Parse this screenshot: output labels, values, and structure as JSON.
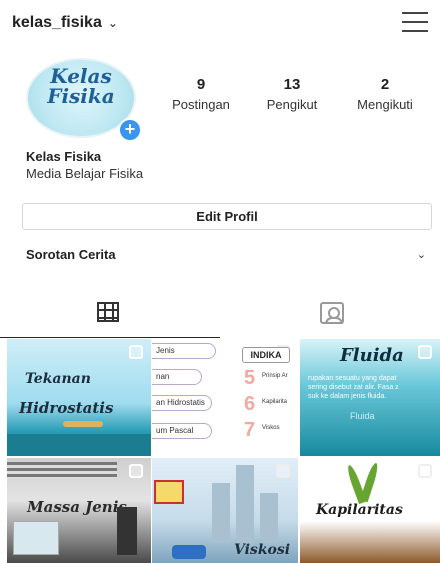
{
  "header": {
    "username": "kelas_fisika",
    "dropdown_glyph": "⌄",
    "menu_icon": "hamburger-icon"
  },
  "profile": {
    "avatar_line1": "Kelas",
    "avatar_line2": "Fisika",
    "add_story_glyph": "+",
    "name": "Kelas Fisika",
    "bio": "Media Belajar Fisika"
  },
  "stats": [
    {
      "value": "9",
      "label": "Postingan"
    },
    {
      "value": "13",
      "label": "Pengikut"
    },
    {
      "value": "2",
      "label": "Mengikuti"
    }
  ],
  "edit_profile_label": "Edit Profil",
  "highlights": {
    "label": "Sorotan Cerita",
    "chevron": "⌄"
  },
  "tabs": [
    {
      "icon": "grid-icon",
      "active": true
    },
    {
      "icon": "tagged-icon",
      "active": false
    }
  ],
  "posts": [
    {
      "title_a": "Tekanan",
      "title_b": "Hidrostatis"
    },
    {
      "badge": "INDIKA",
      "rows": [
        "Jenis",
        "nan",
        "an Hidrostatis",
        "um Pascal"
      ],
      "nums": [
        "5",
        "6",
        "7"
      ],
      "labels": [
        "Prinsip Ar",
        "Kapilarita",
        "Viskos"
      ]
    },
    {
      "title": "Fluida",
      "line1": "rupakan sesuatu yang dapat",
      "line2": "sering disebut zat alir. Fasa z",
      "line3": "suk ke dalam jenis fluida.",
      "mid": "Fluida"
    },
    {
      "title": "Massa Jenis"
    },
    {
      "title": "Viskosi"
    },
    {
      "title": "Kapilaritas"
    }
  ]
}
